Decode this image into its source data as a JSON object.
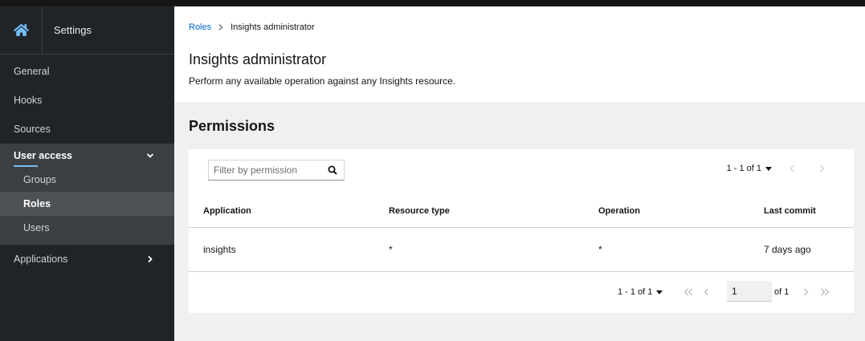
{
  "sidebar": {
    "title": "Settings",
    "items": [
      {
        "label": "General"
      },
      {
        "label": "Hooks"
      },
      {
        "label": "Sources"
      }
    ],
    "group": {
      "label": "User access",
      "children": [
        {
          "label": "Groups"
        },
        {
          "label": "Roles",
          "active": true
        },
        {
          "label": "Users"
        }
      ]
    },
    "applications_label": "Applications"
  },
  "breadcrumb": {
    "parent": "Roles",
    "current": "Insights administrator"
  },
  "page": {
    "title": "Insights administrator",
    "description": "Perform any available operation against any Insights resource."
  },
  "permissions": {
    "section_title": "Permissions",
    "filter_placeholder": "Filter by permission",
    "pagination_top": "1 - 1 of 1",
    "columns": [
      "Application",
      "Resource type",
      "Operation",
      "Last commit"
    ],
    "rows": [
      {
        "application": "insights",
        "resource_type": "*",
        "operation": "*",
        "last_commit": "7 days ago"
      }
    ],
    "pagination_bottom": "1 - 1 of 1",
    "page_input_value": "1",
    "page_of": "of 1"
  },
  "colors": {
    "sidebar_bg": "#212427",
    "link": "#0066cc",
    "active_underline": "#73bcf7"
  }
}
